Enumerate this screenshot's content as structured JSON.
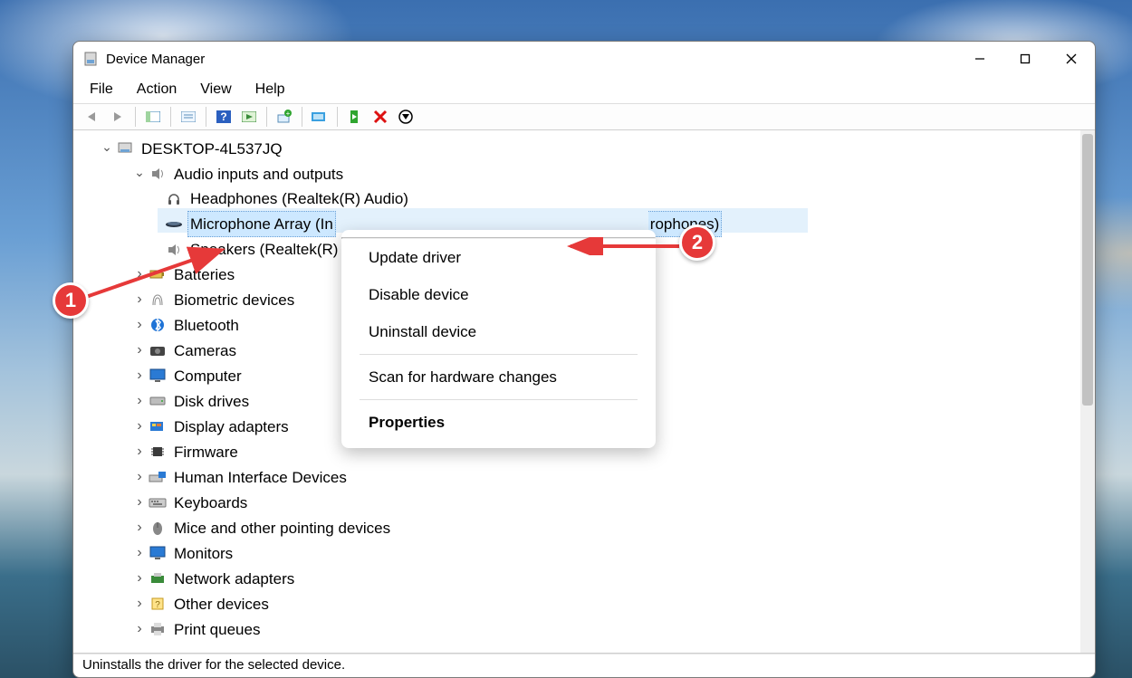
{
  "window": {
    "title": "Device Manager"
  },
  "menu": {
    "file": "File",
    "action": "Action",
    "view": "View",
    "help": "Help"
  },
  "tree": {
    "root": "DESKTOP-4L537JQ",
    "audio": {
      "label": "Audio inputs and outputs",
      "items": {
        "headphones": "Headphones (Realtek(R) Audio)",
        "microphone_full": "Microphone Array (Intel® Smart Sound Technology for Digital Microphones)",
        "microphone_left": "Microphone Array (In",
        "microphone_right": "rophones)",
        "speakers": "Speakers (Realtek(R) A"
      }
    },
    "categories": {
      "batteries": "Batteries",
      "biometric": "Biometric devices",
      "bluetooth": "Bluetooth",
      "cameras": "Cameras",
      "computer": "Computer",
      "disk": "Disk drives",
      "display": "Display adapters",
      "firmware": "Firmware",
      "hid": "Human Interface Devices",
      "keyboards": "Keyboards",
      "mice": "Mice and other pointing devices",
      "monitors": "Monitors",
      "network": "Network adapters",
      "other": "Other devices",
      "print": "Print queues"
    }
  },
  "context_menu": {
    "update": "Update driver",
    "disable": "Disable device",
    "uninstall": "Uninstall device",
    "scan": "Scan for hardware changes",
    "properties": "Properties"
  },
  "statusbar": "Uninstalls the driver for the selected device.",
  "callouts": {
    "one": "1",
    "two": "2"
  }
}
